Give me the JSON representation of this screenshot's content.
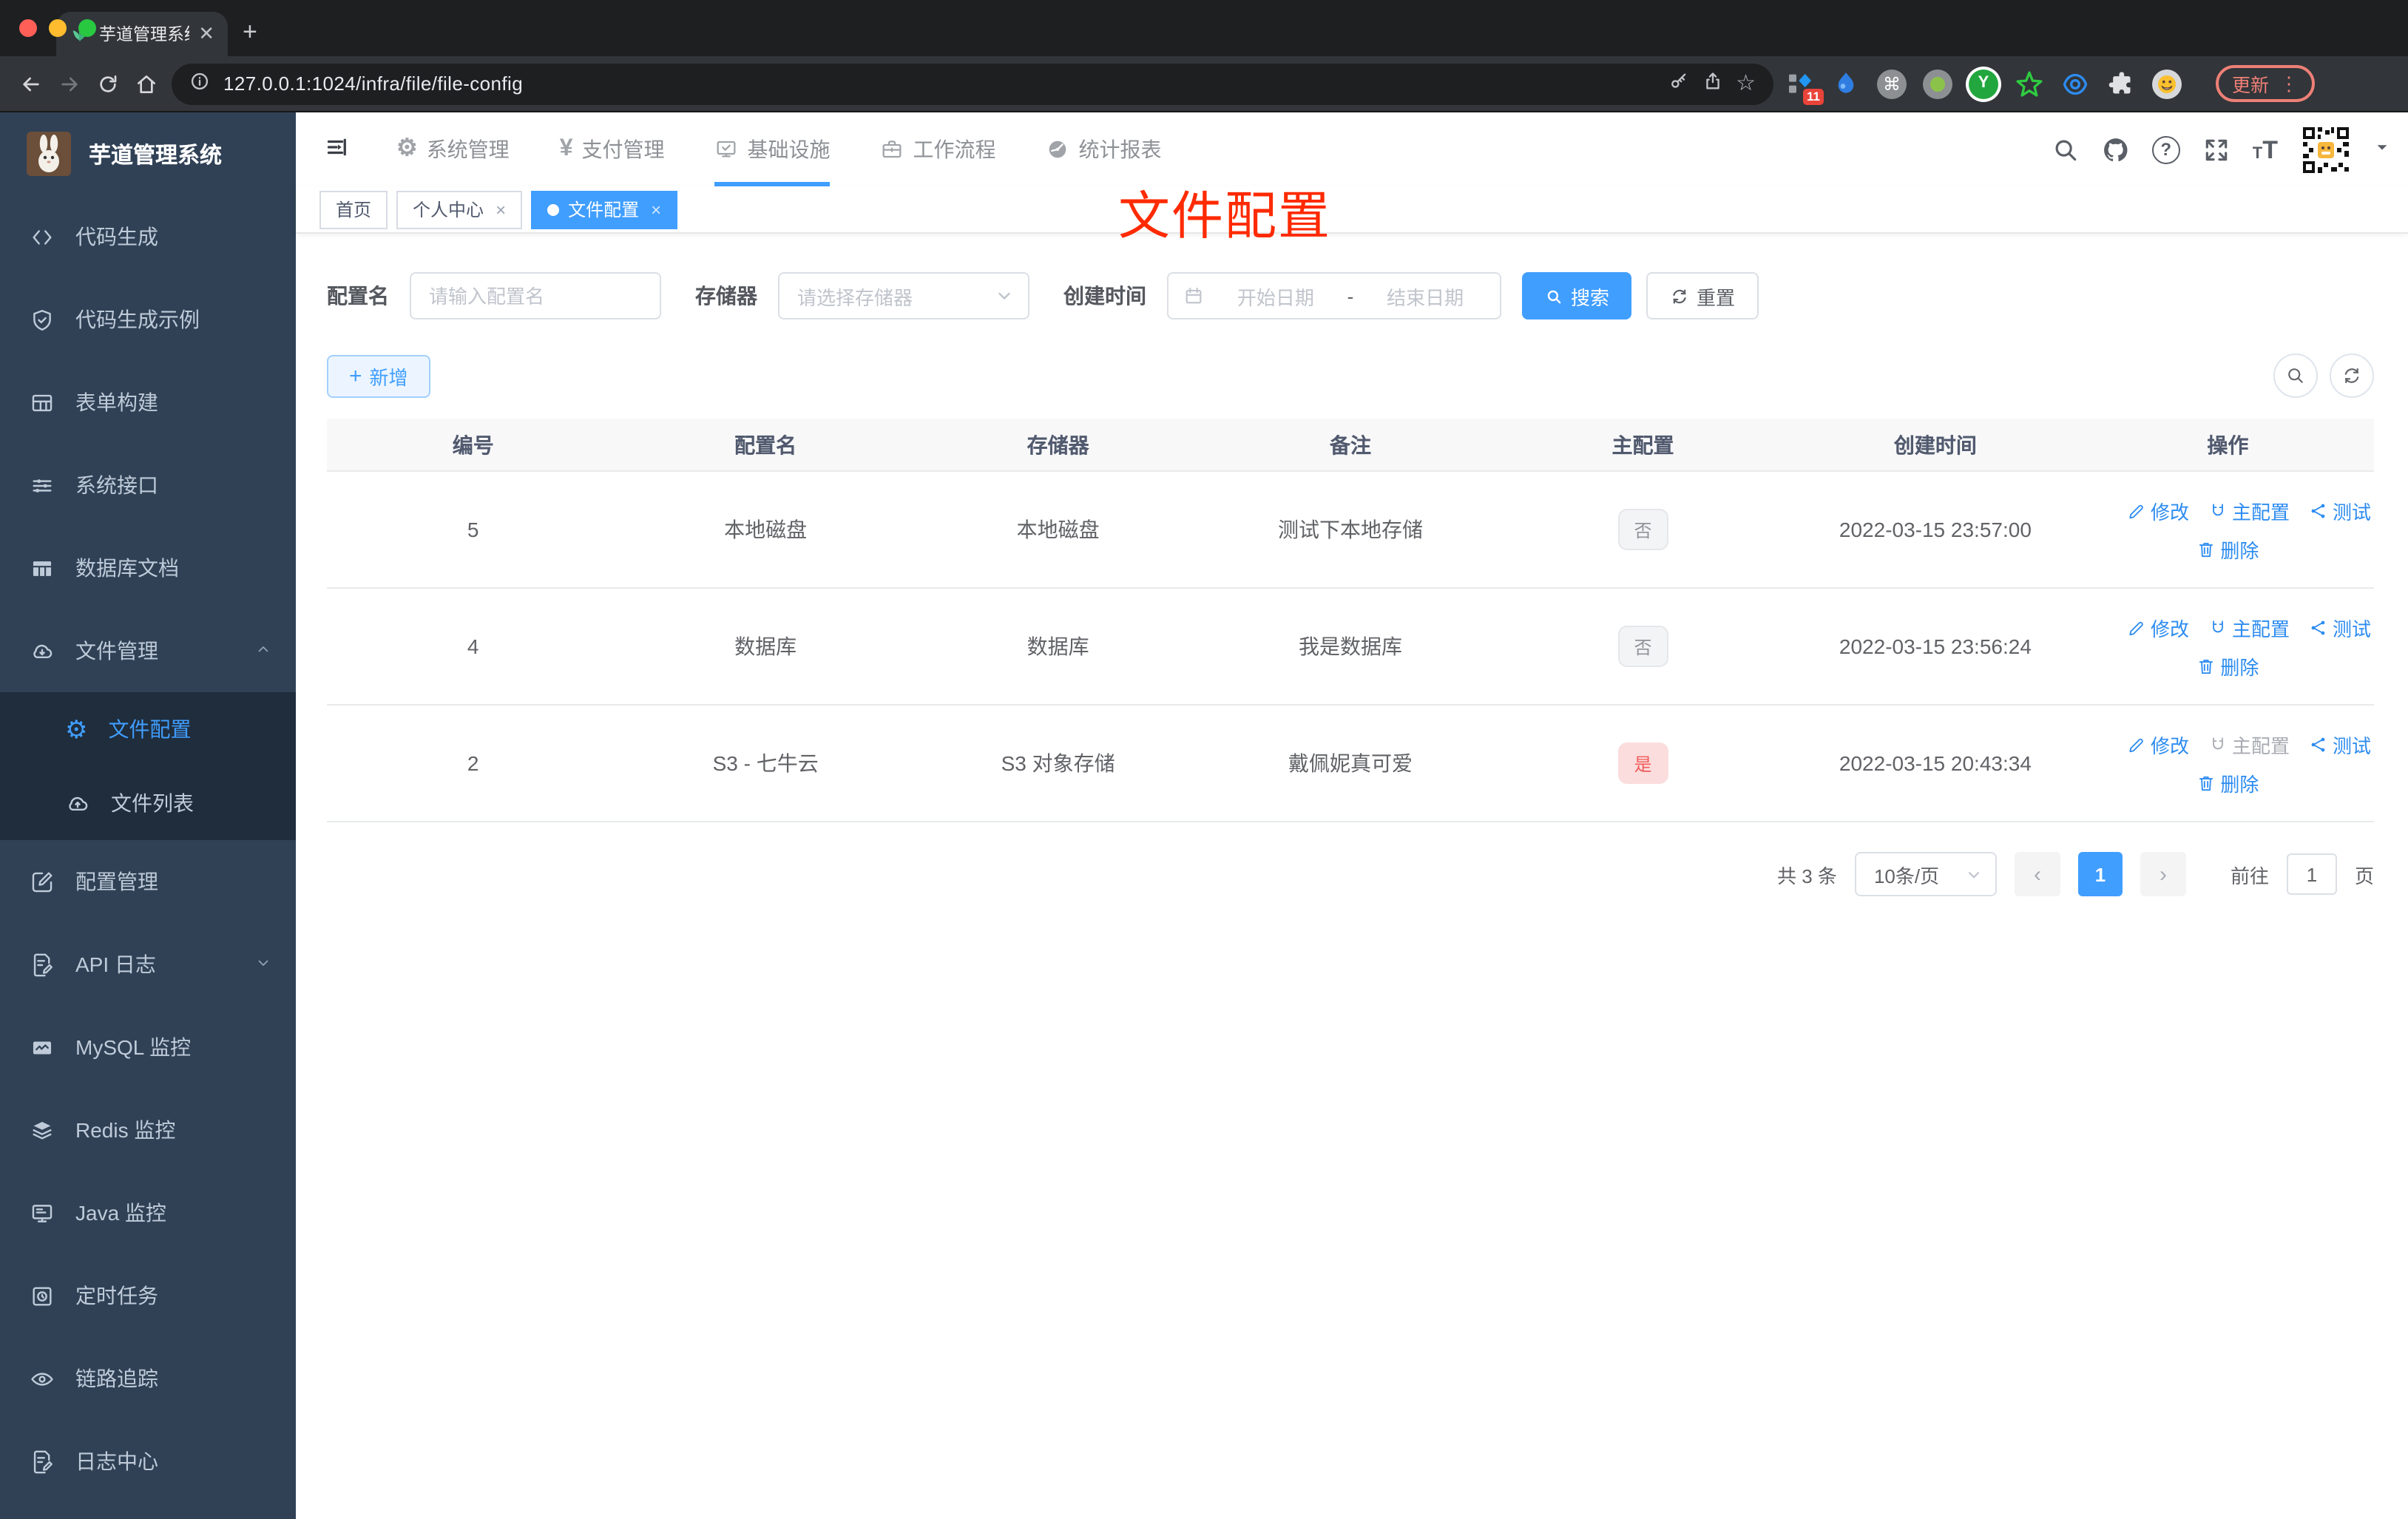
{
  "browser": {
    "tab_title": "芋道管理系统",
    "url": "127.0.0.1:1024/infra/file/file-config",
    "ext_badge": "11",
    "update_label": "更新"
  },
  "sidebar": {
    "title": "芋道管理系统",
    "items": [
      {
        "key": "code-gen",
        "label": "代码生成",
        "icon": "code-icon"
      },
      {
        "key": "code-gen-example",
        "label": "代码生成示例",
        "icon": "shield-check-icon"
      },
      {
        "key": "form-builder",
        "label": "表单构建",
        "icon": "form-icon"
      },
      {
        "key": "system-api",
        "label": "系统接口",
        "icon": "sliders-icon"
      },
      {
        "key": "db-doc",
        "label": "数据库文档",
        "icon": "table-grid-icon"
      },
      {
        "key": "file-manage",
        "label": "文件管理",
        "icon": "cloud-download-icon",
        "arrow": "up",
        "children": [
          {
            "key": "file-config",
            "label": "文件配置",
            "icon": "gear-icon",
            "active": true
          },
          {
            "key": "file-list",
            "label": "文件列表",
            "icon": "cloud-upload-icon"
          }
        ]
      },
      {
        "key": "config-manage",
        "label": "配置管理",
        "icon": "edit-square-icon"
      },
      {
        "key": "api-log",
        "label": "API 日志",
        "icon": "doc-edit-icon",
        "arrow": "down"
      },
      {
        "key": "mysql-monitor",
        "label": "MySQL 监控",
        "icon": "chart-monitor-icon"
      },
      {
        "key": "redis-monitor",
        "label": "Redis 监控",
        "icon": "layers-icon"
      },
      {
        "key": "java-monitor",
        "label": "Java 监控",
        "icon": "display-icon"
      },
      {
        "key": "cron-job",
        "label": "定时任务",
        "icon": "timer-icon"
      },
      {
        "key": "trace",
        "label": "链路追踪",
        "icon": "eye-icon"
      },
      {
        "key": "log-center",
        "label": "日志中心",
        "icon": "doc-edit-icon"
      }
    ]
  },
  "topnav": {
    "items": [
      {
        "key": "system",
        "label": "系统管理",
        "icon": "gear-filled-icon"
      },
      {
        "key": "payment",
        "label": "支付管理",
        "icon": "yen-icon"
      },
      {
        "key": "infra",
        "label": "基础设施",
        "icon": "infra-icon",
        "active": true
      },
      {
        "key": "workflow",
        "label": "工作流程",
        "icon": "briefcase-icon"
      },
      {
        "key": "report",
        "label": "统计报表",
        "icon": "stats-icon"
      }
    ]
  },
  "view_tabs": [
    {
      "key": "home",
      "label": "首页"
    },
    {
      "key": "profile",
      "label": "个人中心",
      "closable": true
    },
    {
      "key": "file-config",
      "label": "文件配置",
      "closable": true,
      "active": true
    }
  ],
  "overlay_title": "文件配置",
  "filters": {
    "name_label": "配置名",
    "name_placeholder": "请输入配置名",
    "storage_label": "存储器",
    "storage_placeholder": "请选择存储器",
    "date_label": "创建时间",
    "date_start_placeholder": "开始日期",
    "date_separator": "-",
    "date_end_placeholder": "结束日期",
    "search_label": "搜索",
    "reset_label": "重置"
  },
  "toolbar": {
    "add_label": "新增"
  },
  "table": {
    "headers": [
      "编号",
      "配置名",
      "存储器",
      "备注",
      "主配置",
      "创建时间",
      "操作"
    ],
    "action_labels": {
      "edit": "修改",
      "master": "主配置",
      "test": "测试",
      "del": "删除"
    },
    "rows": [
      {
        "id": "5",
        "name": "本地磁盘",
        "storage": "本地磁盘",
        "remark": "测试下本地存储",
        "master": "否",
        "master_type": "info",
        "created": "2022-03-15 23:57:00",
        "master_action_disabled": false
      },
      {
        "id": "4",
        "name": "数据库",
        "storage": "数据库",
        "remark": "我是数据库",
        "master": "否",
        "master_type": "info",
        "created": "2022-03-15 23:56:24",
        "master_action_disabled": false
      },
      {
        "id": "2",
        "name": "S3 - 七牛云",
        "storage": "S3 对象存储",
        "remark": "戴佩妮真可爱",
        "master": "是",
        "master_type": "danger",
        "created": "2022-03-15 20:43:34",
        "master_action_disabled": true
      }
    ]
  },
  "pagination": {
    "total": "共 3 条",
    "page_size": "10条/页",
    "prev": "‹",
    "page": "1",
    "next": "›",
    "goto_label": "前往",
    "goto_value": "1",
    "goto_unit": "页"
  },
  "colors": {
    "accent": "#409eff",
    "link": "#2d8cf0",
    "danger": "#f05a5a",
    "overlay_red": "#fe2a00",
    "sidebar_bg": "#304156",
    "submenu_bg": "#1f2d3d"
  }
}
